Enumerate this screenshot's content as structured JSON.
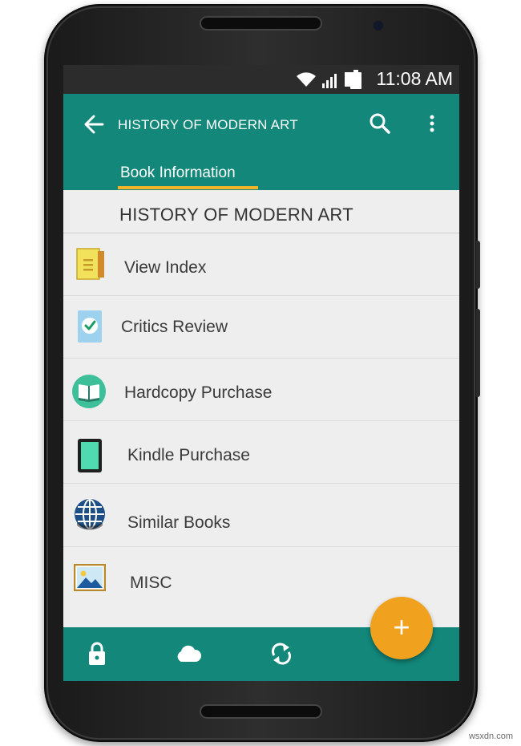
{
  "status_bar": {
    "time": "11:08 AM",
    "icons": [
      "wifi-icon",
      "signal-icon",
      "sim-icon",
      "battery-icon"
    ]
  },
  "app_bar": {
    "title": "HISTORY OF MODERN ART",
    "tab": "Book Information"
  },
  "book": {
    "title": "HISTORY OF MODERN ART"
  },
  "menu": [
    {
      "label": "View Index",
      "icon": "notebook-icon"
    },
    {
      "label": "Critics Review",
      "icon": "checkmark-icon"
    },
    {
      "label": "Hardcopy Purchase",
      "icon": "book-icon"
    },
    {
      "label": "Kindle Purchase",
      "icon": "tablet-icon"
    },
    {
      "label": "Similar Books",
      "icon": "globe-icon"
    },
    {
      "label": "MISC",
      "icon": "image-icon"
    }
  ],
  "bottom_bar": {
    "icons": [
      "lock-icon",
      "cloud-icon",
      "sync-icon"
    ]
  },
  "fab": {
    "label": "+"
  },
  "watermark": "wsxdn.com",
  "colors": {
    "primary": "#12877a",
    "accent": "#f0a21f",
    "tab_indicator": "#f0b429",
    "status_bar": "#2c2c2c"
  }
}
